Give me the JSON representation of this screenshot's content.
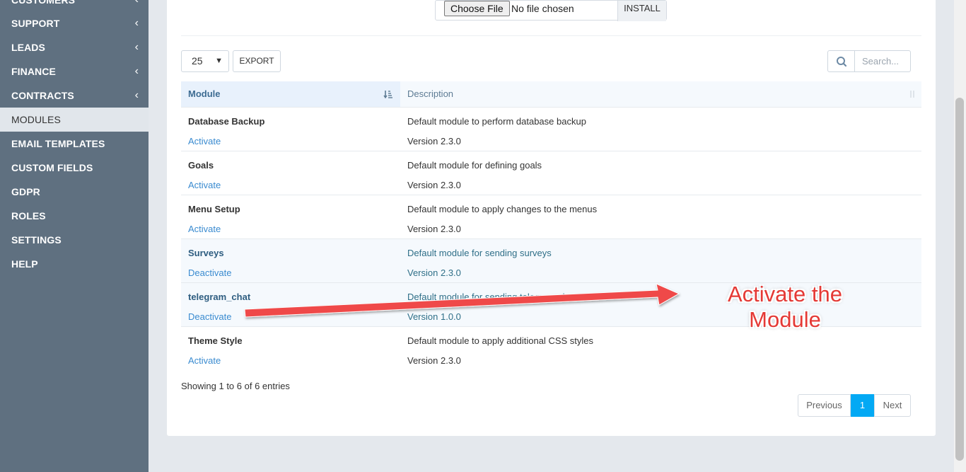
{
  "sidebar": {
    "items": [
      {
        "label": "CUSTOMERS",
        "chevron": "‹"
      },
      {
        "label": "SUPPORT",
        "chevron": "‹"
      },
      {
        "label": "LEADS",
        "chevron": "‹"
      },
      {
        "label": "FINANCE",
        "chevron": "‹"
      },
      {
        "label": "CONTRACTS",
        "chevron": "‹"
      },
      {
        "label": "MODULES",
        "active": true
      },
      {
        "label": "EMAIL TEMPLATES"
      },
      {
        "label": "CUSTOM FIELDS"
      },
      {
        "label": "GDPR"
      },
      {
        "label": "ROLES"
      },
      {
        "label": "SETTINGS"
      },
      {
        "label": "HELP"
      }
    ]
  },
  "upload": {
    "choose_label": "Choose File",
    "file_status": "No file chosen",
    "install_label": "INSTALL"
  },
  "toolbar": {
    "page_length": "25",
    "export_label": "EXPORT",
    "search_placeholder": "Search..."
  },
  "table": {
    "headers": {
      "module": "Module",
      "description": "Description"
    },
    "rows": [
      {
        "name": "Database Backup",
        "action": "Activate",
        "description": "Default module to perform database backup",
        "version": "Version 2.3.0",
        "active": false
      },
      {
        "name": "Goals",
        "action": "Activate",
        "description": "Default module for defining goals",
        "version": "Version 2.3.0",
        "active": false
      },
      {
        "name": "Menu Setup",
        "action": "Activate",
        "description": "Default module to apply changes to the menus",
        "version": "Version 2.3.0",
        "active": false
      },
      {
        "name": "Surveys",
        "action": "Deactivate",
        "description": "Default module for sending surveys",
        "version": "Version 2.3.0",
        "active": true
      },
      {
        "name": "telegram_chat",
        "action": "Deactivate",
        "description": "Default module for sending telegram chat",
        "version": "Version 1.0.0",
        "active": true
      },
      {
        "name": "Theme Style",
        "action": "Activate",
        "description": "Default module to apply additional CSS styles",
        "version": "Version 2.3.0",
        "active": false
      }
    ]
  },
  "info": "Showing 1 to 6 of 6 entries",
  "pagination": {
    "previous": "Previous",
    "current": "1",
    "next": "Next"
  },
  "annotation": {
    "line1": "Activate the",
    "line2": "Module",
    "color": "#e53935"
  },
  "colors": {
    "sidebar_bg": "#5f7080",
    "accent": "#03a9f4",
    "link": "#3a8bd0"
  }
}
